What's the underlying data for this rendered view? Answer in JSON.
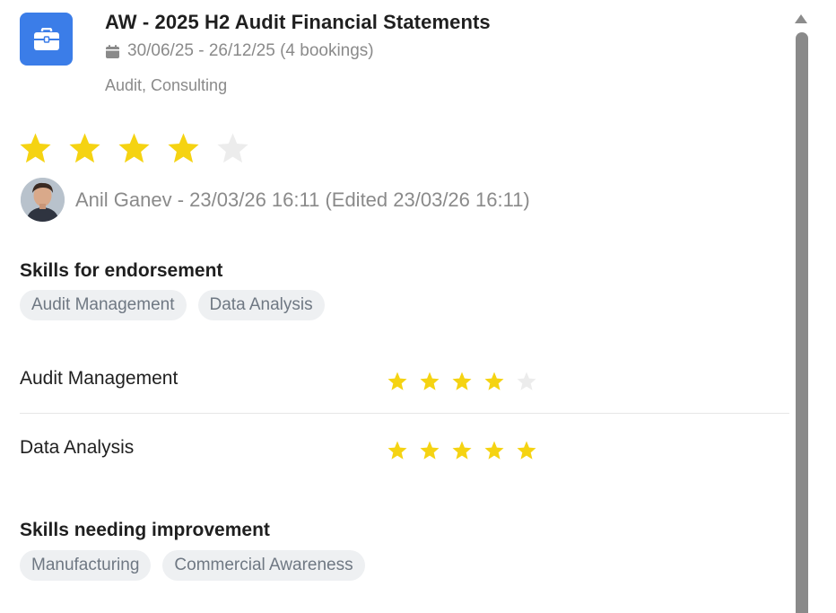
{
  "colors": {
    "accent": "#3b7de8",
    "star_filled": "#f5d312",
    "star_empty": "#ececec"
  },
  "project": {
    "icon": "briefcase-icon",
    "title": "AW - 2025 H2 Audit Financial Statements",
    "date_icon": "calendar-icon",
    "dates": "30/06/25 - 26/12/25 (4 bookings)",
    "tags": "Audit, Consulting"
  },
  "overall_rating": {
    "value": 4,
    "max": 5
  },
  "reviewer": {
    "avatar": "avatar",
    "text": "Anil Ganev - 23/03/26 16:11 (Edited 23/03/26 16:11)"
  },
  "endorsement": {
    "title": "Skills for endorsement",
    "chips": [
      "Audit Management",
      "Data Analysis"
    ]
  },
  "skill_ratings": [
    {
      "name": "Audit Management",
      "value": 4,
      "max": 5
    },
    {
      "name": "Data Analysis",
      "value": 5,
      "max": 5
    }
  ],
  "improvement": {
    "title": "Skills needing improvement",
    "chips": [
      "Manufacturing",
      "Commercial Awareness"
    ]
  }
}
